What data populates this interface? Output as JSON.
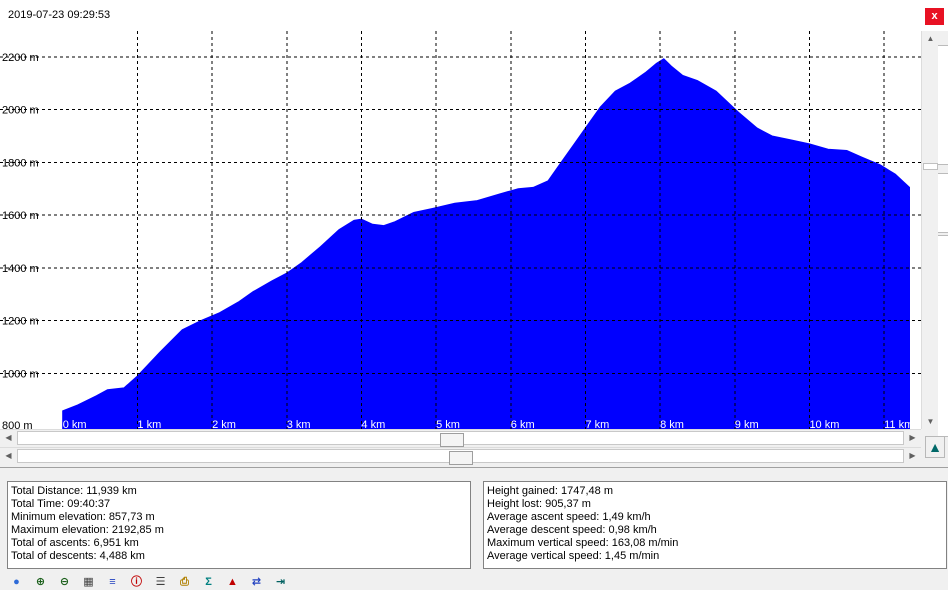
{
  "window": {
    "title": "2019-07-23 09:29:53",
    "close_glyph": "x"
  },
  "chart_data": {
    "type": "area",
    "color": "#0000ff",
    "xlabel": "",
    "ylabel": "",
    "xlim": [
      -0.01,
      11.36
    ],
    "ylim": [
      789,
      2298
    ],
    "grid": true,
    "y_ticks": [
      800,
      1000,
      1200,
      1400,
      1600,
      1800,
      2000,
      2200
    ],
    "y_tick_labels": [
      "800 m",
      "1000 m",
      "1200 m",
      "1400 m",
      "1600 m",
      "1800 m",
      "2000 m",
      "2200 m"
    ],
    "x_ticks": [
      0,
      1,
      2,
      3,
      4,
      5,
      6,
      7,
      8,
      9,
      10,
      11
    ],
    "x_tick_labels": [
      "0 km",
      "1 km",
      "2 km",
      "3 km",
      "4 km",
      "5 km",
      "6 km",
      "7 km",
      "8 km",
      "9 km",
      "10 km",
      "11 km"
    ],
    "x": [
      0,
      0.2,
      0.45,
      0.6,
      0.82,
      1.0,
      1.3,
      1.6,
      1.85,
      2.1,
      2.35,
      2.55,
      2.8,
      3.0,
      3.2,
      3.45,
      3.7,
      3.9,
      4.0,
      4.15,
      4.3,
      4.45,
      4.7,
      4.95,
      5.25,
      5.55,
      5.85,
      6.1,
      6.3,
      6.5,
      6.7,
      6.85,
      7.0,
      7.2,
      7.4,
      7.6,
      7.8,
      7.95,
      8.05,
      8.15,
      8.3,
      8.5,
      8.75,
      9.05,
      9.3,
      9.5,
      9.75,
      10.0,
      10.25,
      10.5,
      10.7,
      10.95,
      11.15,
      11.34
    ],
    "y": [
      858,
      880,
      915,
      938,
      945,
      990,
      1080,
      1165,
      1200,
      1230,
      1270,
      1310,
      1350,
      1380,
      1420,
      1480,
      1545,
      1580,
      1585,
      1565,
      1560,
      1575,
      1610,
      1625,
      1645,
      1655,
      1680,
      1700,
      1705,
      1730,
      1810,
      1870,
      1930,
      2010,
      2070,
      2100,
      2140,
      2175,
      2192.85,
      2165,
      2130,
      2110,
      2070,
      1990,
      1930,
      1900,
      1885,
      1870,
      1850,
      1845,
      1820,
      1790,
      1755,
      1705
    ]
  },
  "stats_left": [
    "Total Distance: 11,939 km",
    "Total Time: 09:40:37",
    "Minimum elevation: 857,73 m",
    "Maximum elevation: 2192,85 m",
    "Total of ascents: 6,951 km",
    "Total of descents: 4,488 km"
  ],
  "stats_right": [
    "Height gained: 1747,48 m",
    "Height lost: 905,37 m",
    "Average ascent speed: 1,49 km/h",
    "Average descent speed: 0,98 km/h",
    "Maximum vertical speed: 163,08 m/min",
    "Average vertical speed: 1,45 m/min"
  ],
  "scrollbars": {
    "h1_position": 0.49,
    "h2_position": 0.5,
    "v_position": 0.34
  },
  "toolbar": {
    "icons": [
      "globe-icon",
      "zoom-in-icon",
      "zoom-out-icon",
      "grid-icon",
      "settings-list-icon",
      "info-icon",
      "document-icon",
      "print-icon",
      "sum-icon",
      "color-fill-icon",
      "swap-icon",
      "export-icon"
    ],
    "glyphs": [
      "●",
      "⊕",
      "⊖",
      "▦",
      "≡",
      "ⓘ",
      "☰",
      "⎙",
      "Σ",
      "▲",
      "⇄",
      "⇥"
    ],
    "colors": [
      "#2e6bd8",
      "#1a5f1a",
      "#1a5f1a",
      "#404040",
      "#1f3fbf",
      "#c00000",
      "#404040",
      "#b08000",
      "#008080",
      "#c00000",
      "#1f3fbf",
      "#006060"
    ]
  },
  "expand_glyph": "▲"
}
